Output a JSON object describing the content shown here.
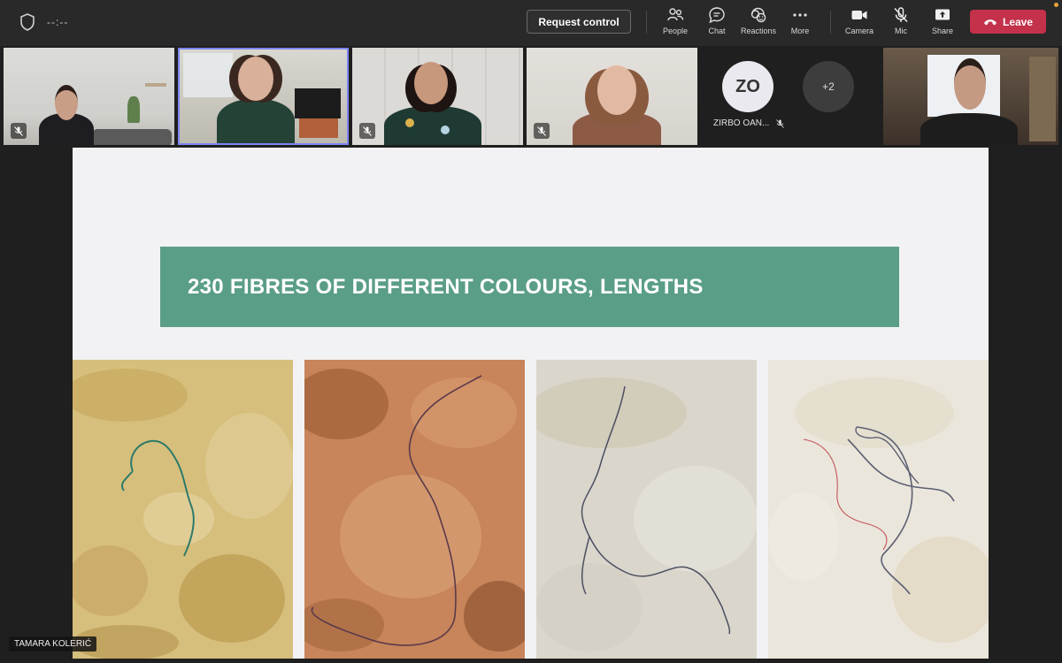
{
  "toolbar": {
    "timer": "--:--",
    "request_control": "Request control",
    "people": "People",
    "chat": "Chat",
    "reactions": "Reactions",
    "more": "More",
    "camera": "Camera",
    "mic": "Mic",
    "share": "Share",
    "leave": "Leave"
  },
  "participants": {
    "zo_initials": "ZO",
    "zo_name": "ZIRBO OAN...",
    "overflow": "+2"
  },
  "slide": {
    "title": "230 FIBRES OF DIFFERENT COLOURS, LENGTHS"
  },
  "presenter": {
    "name": "TAMARA KOLERIĆ"
  },
  "colors": {
    "leave_red": "#c4314b",
    "banner_green": "#5b9e87",
    "active_border": "#7f85f5"
  }
}
